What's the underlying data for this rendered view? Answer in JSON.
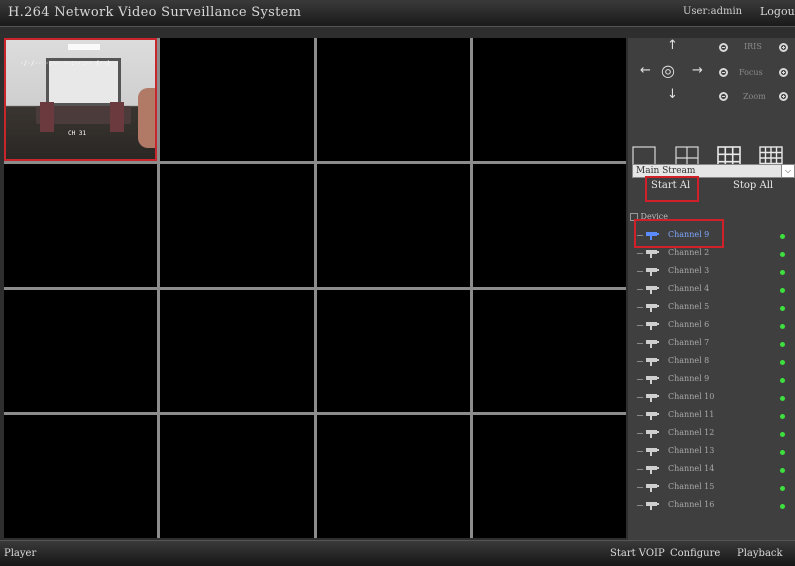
{
  "header": {
    "title": "H.264 Network Video Surveillance System",
    "user": "User:admin",
    "logout": "Logout"
  },
  "video": {
    "active_cell": 0,
    "cam1": {
      "timestamp": "·/·/·· ·:·· ··:··:·· (··)",
      "channel_osd": "CH 31"
    }
  },
  "ptz": {
    "iris_label": "IRIS",
    "focus_label": "Focus",
    "zoom_label": "Zoom"
  },
  "stream": {
    "selected": "Main Stream",
    "start_all": "Start Al",
    "stop_all": "Stop All"
  },
  "device_tree": {
    "root": "Device",
    "channels": [
      "Channel  9",
      "Channel  2",
      "Channel  3",
      "Channel  4",
      "Channel  5",
      "Channel  6",
      "Channel  7",
      "Channel  8",
      "Channel  9",
      "Channel  10",
      "Channel  11",
      "Channel  12",
      "Channel  13",
      "Channel  14",
      "Channel  15",
      "Channel  16"
    ],
    "selected_index": 0
  },
  "footer": {
    "player": "Player",
    "start_voip": "Start VOIP",
    "configure": "Configure",
    "playback": "Playback"
  },
  "colors": {
    "highlight_red": "#d0202a",
    "status_green": "#3ee03e",
    "selected_blue": "#7fa7ff"
  }
}
